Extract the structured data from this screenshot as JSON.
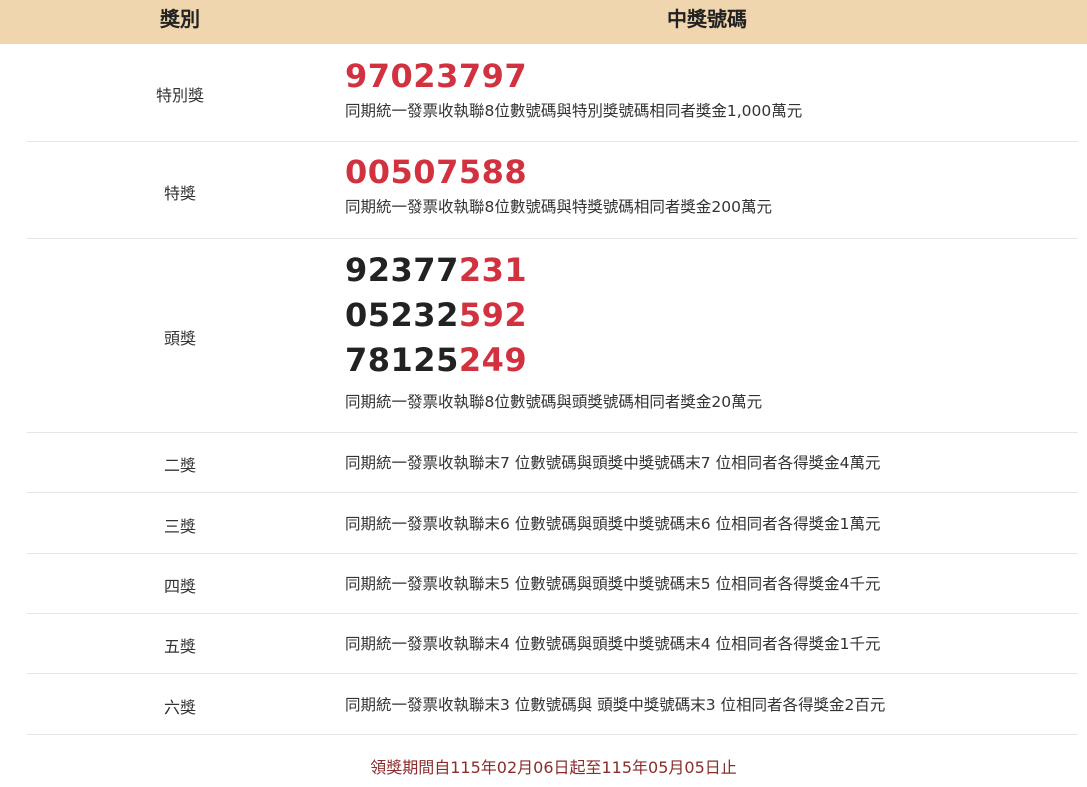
{
  "header": {
    "prize_col": "獎別",
    "number_col": "中獎號碼"
  },
  "special_prize": {
    "name": "特別獎",
    "number": "97023797",
    "desc": "同期統一發票收執聯8位數號碼與特別獎號碼相同者獎金1,000萬元"
  },
  "grand_prize": {
    "name": "特獎",
    "number": "00507588",
    "desc": "同期統一發票收執聯8位數號碼與特獎號碼相同者獎金200萬元"
  },
  "first_prize": {
    "name": "頭獎",
    "numbers": [
      {
        "head": "92377",
        "tail": "231"
      },
      {
        "head": "05232",
        "tail": "592"
      },
      {
        "head": "78125",
        "tail": "249"
      }
    ],
    "desc": "同期統一發票收執聯8位數號碼與頭獎號碼相同者獎金20萬元"
  },
  "other_prizes": [
    {
      "name": "二獎",
      "desc": "同期統一發票收執聯末7 位數號碼與頭獎中獎號碼末7 位相同者各得獎金4萬元"
    },
    {
      "name": "三獎",
      "desc": "同期統一發票收執聯末6 位數號碼與頭獎中獎號碼末6 位相同者各得獎金1萬元"
    },
    {
      "name": "四獎",
      "desc": "同期統一發票收執聯末5 位數號碼與頭獎中獎號碼末5 位相同者各得獎金4千元"
    },
    {
      "name": "五獎",
      "desc": "同期統一發票收執聯末4 位數號碼與頭獎中獎號碼末4 位相同者各得獎金1千元"
    },
    {
      "name": "六獎",
      "desc": "同期統一發票收執聯末3 位數號碼與 頭獎中獎號碼末3 位相同者各得獎金2百元"
    }
  ],
  "footer": {
    "claim_period": "領獎期間自115年02月06日起至115年05月05日止"
  },
  "colors": {
    "header_bg": "#f0d6ae",
    "number_red": "#d2323f",
    "footer_text": "#8b2c2c"
  }
}
